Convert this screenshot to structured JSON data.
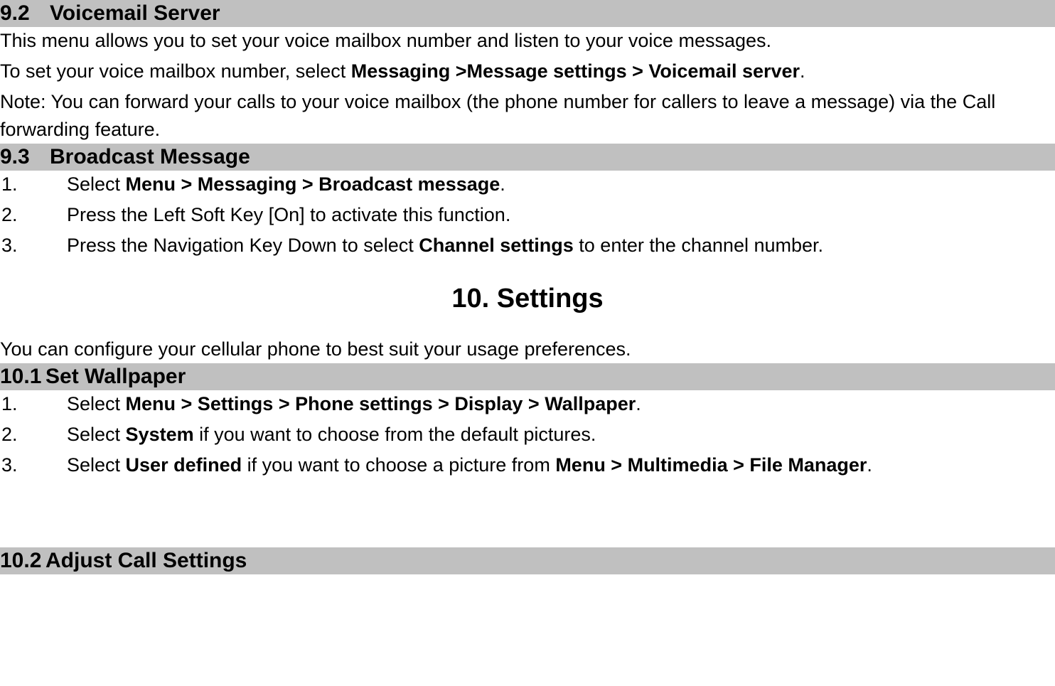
{
  "sec92": {
    "num": "9.2",
    "title": "Voicemail Server",
    "p1": "This menu allows you to set your voice mailbox number and listen to your voice messages.",
    "p2a": "To set your voice mailbox number, select ",
    "p2b": "Messaging >Message settings > Voicemail server",
    "p2c": ".",
    "p3": "Note: You can forward your calls to your voice mailbox (the phone number for callers to leave a message) via the Call forwarding feature."
  },
  "sec93": {
    "num": "9.3",
    "title": "Broadcast Message",
    "items": [
      {
        "marker": "1.",
        "pre": "Select ",
        "bold": "Menu > Messaging > Broadcast message",
        "post": "."
      },
      {
        "marker": "2.",
        "pre": "Press the Left Soft Key [On] to activate this function.",
        "bold": "",
        "post": ""
      },
      {
        "marker": "3.",
        "pre": "Press the Navigation Key Down to select ",
        "bold": "Channel settings",
        "post": " to enter the channel number."
      }
    ]
  },
  "sec10": {
    "title": "10. Settings",
    "intro": "You can configure your cellular phone to best suit your usage preferences."
  },
  "sec101": {
    "num": "10.1",
    "title": "Set Wallpaper",
    "items": [
      {
        "marker": "1.",
        "pre": "Select ",
        "bold": "Menu > Settings > Phone settings > Display > Wallpaper",
        "post": "."
      },
      {
        "marker": "2.",
        "pre": "Select ",
        "bold": "System",
        "post": " if you want to choose from the default pictures."
      },
      {
        "marker": "3.",
        "pre": "Select ",
        "bold": "User defined",
        "mid": " if you want to choose a picture from ",
        "bold2": "Menu > Multimedia > File Manager",
        "post": "."
      }
    ]
  },
  "sec102": {
    "num": "10.2",
    "title": "Adjust Call Settings"
  }
}
